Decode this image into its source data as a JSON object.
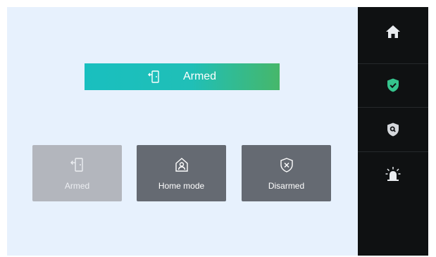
{
  "status_banner": {
    "label": "Armed",
    "icon": "door-exit-icon"
  },
  "modes": [
    {
      "label": "Armed",
      "icon": "door-exit-icon",
      "state": "selected"
    },
    {
      "label": "Home mode",
      "icon": "home-person-icon",
      "state": "normal"
    },
    {
      "label": "Disarmed",
      "icon": "shield-x-icon",
      "state": "normal"
    }
  ],
  "sidebar": {
    "items": [
      {
        "name": "home",
        "icon": "home-icon",
        "active": false
      },
      {
        "name": "security",
        "icon": "shield-check-icon",
        "active": true
      },
      {
        "name": "search",
        "icon": "shield-search-icon",
        "active": false
      },
      {
        "name": "alarm",
        "icon": "alarm-light-icon",
        "active": false
      }
    ]
  },
  "colors": {
    "background": "#e7f1fd",
    "banner_start": "#19bfbf",
    "banner_end": "#46b76a",
    "button_dark": "#656a72",
    "button_selected": "#b3b6bd",
    "sidebar": "#0f1112",
    "accent_green": "#35c48d"
  }
}
